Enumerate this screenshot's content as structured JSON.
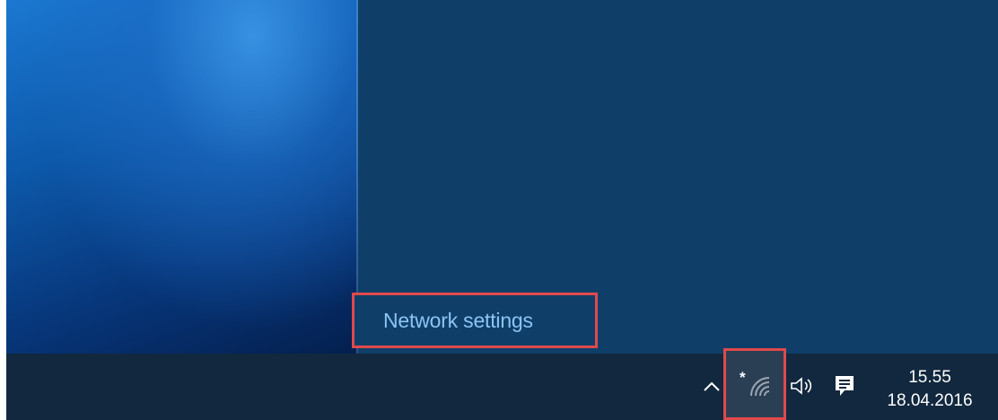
{
  "flyout": {
    "network_settings_label": "Network settings"
  },
  "tray": {
    "icons": [
      "chevron-up-icon",
      "wifi-icon",
      "volume-icon",
      "action-center-icon"
    ],
    "time": "15.55",
    "date": "18.04.2016"
  },
  "colors": {
    "highlight": "#e0494b",
    "link": "#8dc3f5",
    "flyout_bg": "#0f3f68",
    "taskbar_bg": "#12283f"
  }
}
